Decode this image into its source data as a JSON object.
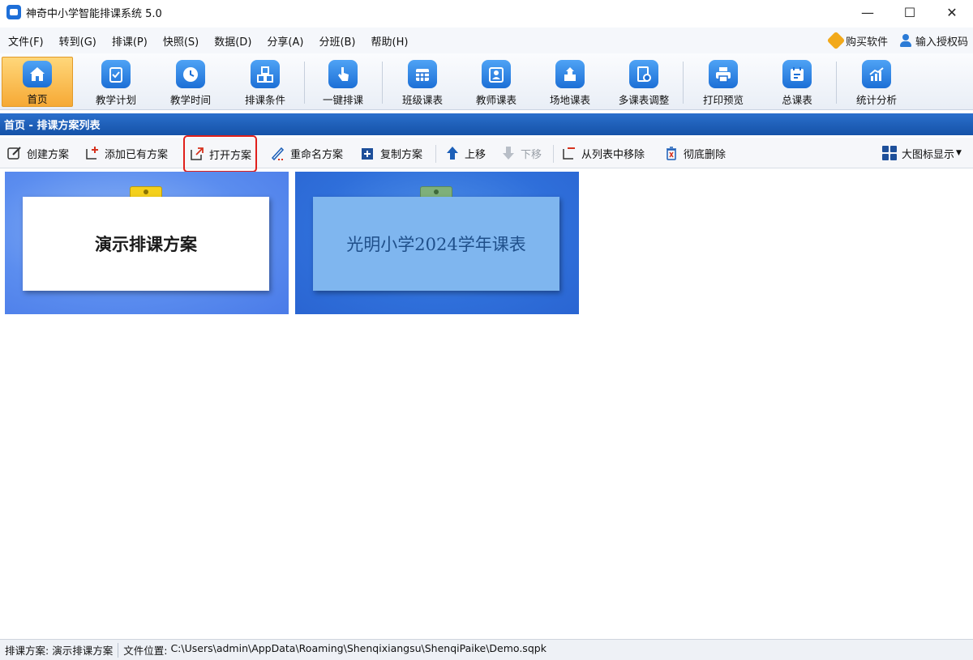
{
  "window": {
    "title": "神奇中小学智能排课系统 5.0",
    "minimize": "—",
    "maximize": "☐",
    "close": "✕"
  },
  "menu": {
    "items": [
      "文件(F)",
      "转到(G)",
      "排课(P)",
      "快照(S)",
      "数据(D)",
      "分享(A)",
      "分班(B)",
      "帮助(H)"
    ],
    "buy": "购买软件",
    "auth": "输入授权码"
  },
  "ribbon": {
    "items": [
      {
        "label": "首页",
        "icon": "home-icon",
        "active": true
      },
      {
        "label": "教学计划",
        "icon": "clipboard-check-icon"
      },
      {
        "label": "教学时间",
        "icon": "clock-icon"
      },
      {
        "label": "排课条件",
        "icon": "cubes-icon"
      },
      {
        "label": "一键排课",
        "icon": "pointer-hand-icon"
      },
      {
        "label": "班级课表",
        "icon": "calendar-grid-icon"
      },
      {
        "label": "教师课表",
        "icon": "teacher-icon"
      },
      {
        "label": "场地课表",
        "icon": "building-icon"
      },
      {
        "label": "多课表调整",
        "icon": "doc-adjust-icon"
      },
      {
        "label": "打印预览",
        "icon": "printer-icon"
      },
      {
        "label": "总课表",
        "icon": "schedule-icon"
      },
      {
        "label": "统计分析",
        "icon": "chart-icon"
      }
    ]
  },
  "section": {
    "title": "首页 - 排课方案列表"
  },
  "toolbar": {
    "create": "创建方案",
    "add_existing": "添加已有方案",
    "open": "打开方案",
    "rename": "重命名方案",
    "copy": "复制方案",
    "move_up": "上移",
    "move_down": "下移",
    "remove_from_list": "从列表中移除",
    "delete": "彻底删除",
    "view_mode": "大图标显示"
  },
  "plans": [
    {
      "name": "演示排课方案",
      "selected": true
    },
    {
      "name": "光明小学2024学年课表",
      "selected": false
    }
  ],
  "status": {
    "plan_label": "排课方案:",
    "plan_value": "演示排课方案",
    "path_label": "文件位置:",
    "path_value": "C:\\Users\\admin\\AppData\\Roaming\\Shenqixiangsu\\ShenqiPaike\\Demo.sqpk"
  },
  "colors": {
    "accent": "#1552a8",
    "active_tab": "#f6a935",
    "highlight": "#e0201c"
  }
}
